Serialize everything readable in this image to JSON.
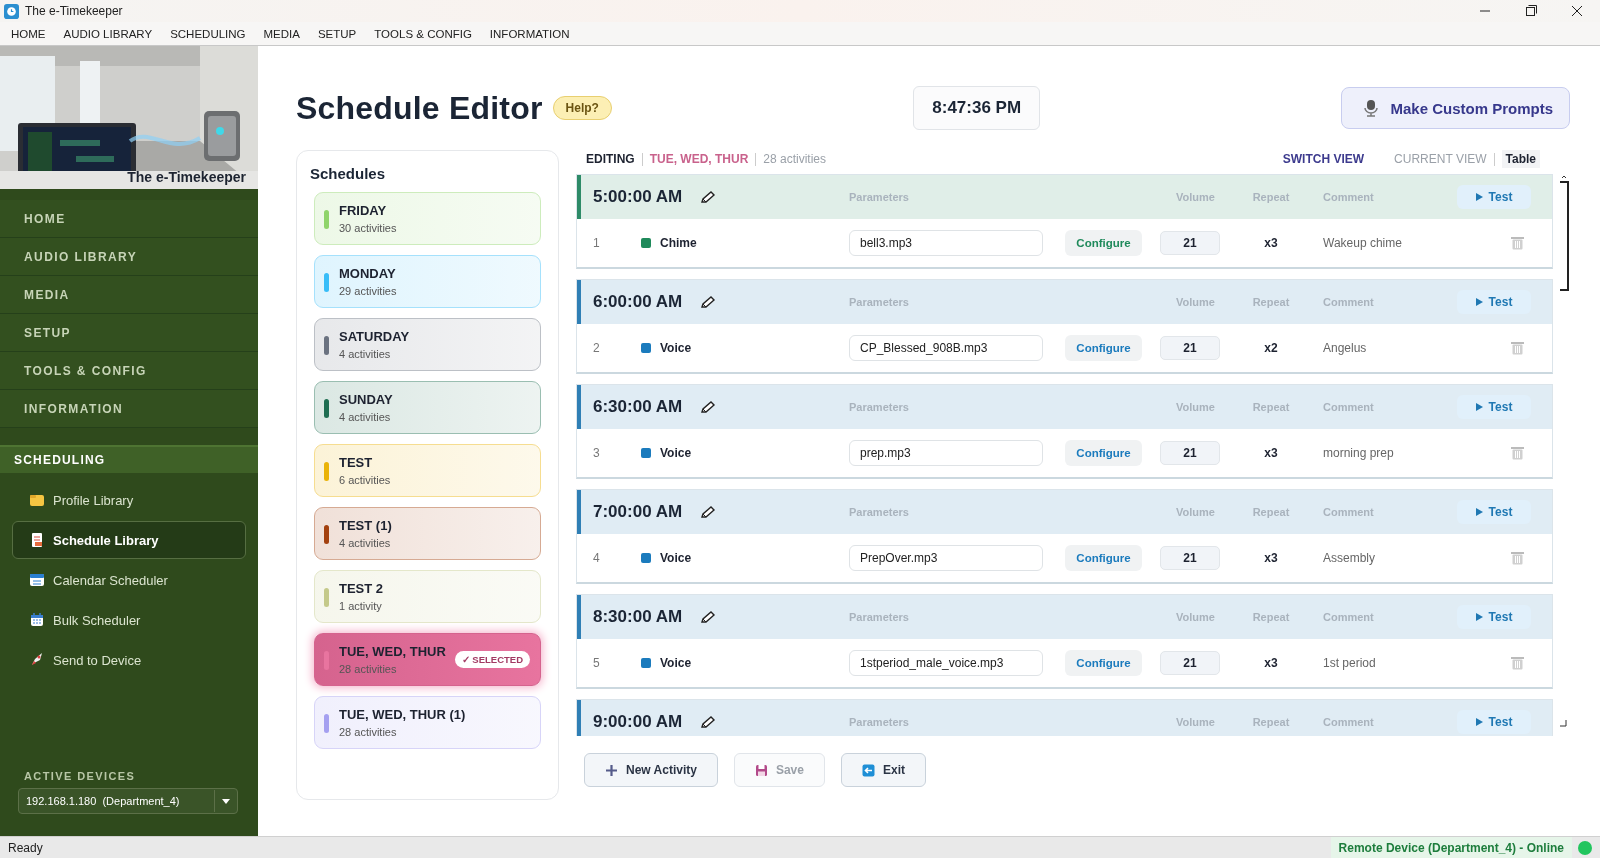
{
  "window": {
    "title": "The e-Timekeeper"
  },
  "menu_bar": [
    "HOME",
    "AUDIO LIBRARY",
    "SCHEDULING",
    "MEDIA",
    "SETUP",
    "TOOLS & CONFIG",
    "INFORMATION"
  ],
  "sidebar": {
    "banner_caption": "The e-Timekeeper",
    "nav": [
      "HOME",
      "AUDIO LIBRARY",
      "MEDIA",
      "SETUP",
      "TOOLS & CONFIG",
      "INFORMATION"
    ],
    "section": "SCHEDULING",
    "items": [
      {
        "label": "Profile Library",
        "selected": false
      },
      {
        "label": "Schedule Library",
        "selected": true
      },
      {
        "label": "Calendar Scheduler",
        "selected": false
      },
      {
        "label": "Bulk Scheduler",
        "selected": false
      },
      {
        "label": "Send to Device",
        "selected": false
      }
    ],
    "devices_label": "ACTIVE DEVICES",
    "device": "192.168.1.180  (Department_4)"
  },
  "header": {
    "title": "Schedule Editor",
    "help": "Help?",
    "clock": "8:47:36 PM",
    "prompts_button": "Make Custom Prompts"
  },
  "schedules": {
    "title": "Schedules",
    "selected_badge": "✓ SELECTED",
    "items": [
      {
        "name": "FRIDAY",
        "count": "30 activities",
        "color": "#8fd46a",
        "selected": false
      },
      {
        "name": "MONDAY",
        "count": "29 activities",
        "color": "#38bdf8",
        "selected": false
      },
      {
        "name": "SATURDAY",
        "count": "4 activities",
        "color": "#6b7280",
        "selected": false
      },
      {
        "name": "SUNDAY",
        "count": "4 activities",
        "color": "#1f6e52",
        "selected": false
      },
      {
        "name": "TEST",
        "count": "6 activities",
        "color": "#eab308",
        "selected": false
      },
      {
        "name": "TEST (1)",
        "count": "4 activities",
        "color": "#a3410f",
        "selected": false
      },
      {
        "name": "TEST 2",
        "count": "1 activity",
        "color": "#c4c98a",
        "selected": false
      },
      {
        "name": "TUE, WED, THUR",
        "count": "28 activities",
        "color": "#e8749f",
        "selected": true
      },
      {
        "name": "TUE, WED, THUR (1)",
        "count": "28 activities",
        "color": "#a5a0f0",
        "selected": false
      }
    ]
  },
  "editor": {
    "label": "EDITING",
    "schedule": "TUE, WED, THUR",
    "count": "28 activities",
    "switch_view": "SWITCH VIEW",
    "current_view_label": "CURRENT VIEW",
    "current_view": "Table",
    "activities": [
      {
        "time": "5:00:00 AM",
        "color": "#2e8b68",
        "columns": [
          "Parameters",
          "Volume",
          "Repeat",
          "Comment"
        ],
        "test": "Test",
        "row": {
          "number": "1",
          "type": "Chime",
          "color": "#1f8a5b",
          "file": "bell3.mp3",
          "configure": "Configure",
          "volume": "21",
          "repeat": "x3",
          "comment": "Wakeup chime"
        }
      },
      {
        "time": "6:00:00 AM",
        "color": "#2f7fb5",
        "columns": [
          "Parameters",
          "Volume",
          "Repeat",
          "Comment"
        ],
        "test": "Test",
        "row": {
          "number": "2",
          "type": "Voice",
          "color": "#1b7bbd",
          "file": "CP_Blessed_908B.mp3",
          "configure": "Configure",
          "volume": "21",
          "repeat": "x2",
          "comment": "Angelus"
        }
      },
      {
        "time": "6:30:00 AM",
        "color": "#2f7fb5",
        "columns": [
          "Parameters",
          "Volume",
          "Repeat",
          "Comment"
        ],
        "test": "Test",
        "row": {
          "number": "3",
          "type": "Voice",
          "color": "#1b7bbd",
          "file": "prep.mp3",
          "configure": "Configure",
          "volume": "21",
          "repeat": "x3",
          "comment": "morning prep"
        }
      },
      {
        "time": "7:00:00 AM",
        "color": "#2f7fb5",
        "columns": [
          "Parameters",
          "Volume",
          "Repeat",
          "Comment"
        ],
        "test": "Test",
        "row": {
          "number": "4",
          "type": "Voice",
          "color": "#1b7bbd",
          "file": "PrepOver.mp3",
          "configure": "Configure",
          "volume": "21",
          "repeat": "x3",
          "comment": "Assembly"
        }
      },
      {
        "time": "8:30:00 AM",
        "color": "#2f7fb5",
        "columns": [
          "Parameters",
          "Volume",
          "Repeat",
          "Comment"
        ],
        "test": "Test",
        "row": {
          "number": "5",
          "type": "Voice",
          "color": "#1b7bbd",
          "file": "1stperiod_male_voice.mp3",
          "configure": "Configure",
          "volume": "21",
          "repeat": "x3",
          "comment": "1st period"
        }
      },
      {
        "time": "9:00:00 AM",
        "color": "#2f7fb5",
        "columns": [
          "Parameters",
          "Volume",
          "Repeat",
          "Comment"
        ],
        "test": "Test"
      }
    ],
    "buttons": [
      {
        "label": "New Activity",
        "disabled": false
      },
      {
        "label": "Save",
        "disabled": true
      },
      {
        "label": "Exit",
        "disabled": false
      }
    ]
  },
  "status_bar": {
    "text": "Ready",
    "device_status": "Remote Device (Department_4) - Online",
    "online": true
  }
}
